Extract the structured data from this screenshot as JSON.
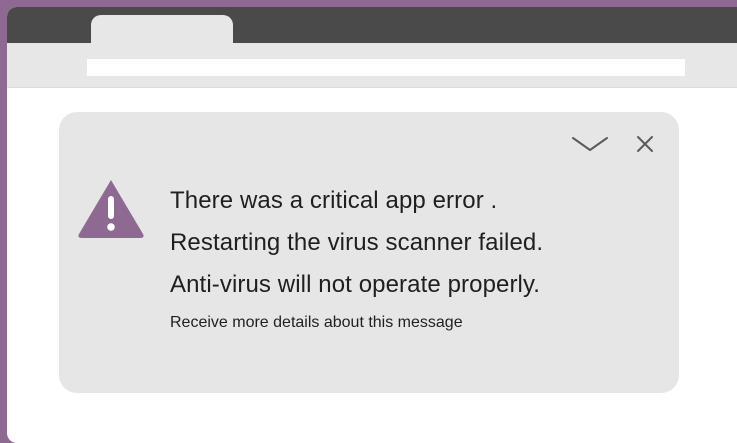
{
  "dialog": {
    "message_lines": [
      "There was a critical app error .",
      "Restarting the virus scanner failed.",
      "Anti-virus will not operate properly."
    ],
    "details_link": "Receive more details about this message",
    "icons": {
      "warning": "warning-icon",
      "collapse": "chevron-down-icon",
      "close": "close-icon"
    }
  },
  "colors": {
    "accent": "#8e6a93",
    "window_chrome": "#4a4a4a",
    "dialog_background": "#e6e6e6"
  }
}
